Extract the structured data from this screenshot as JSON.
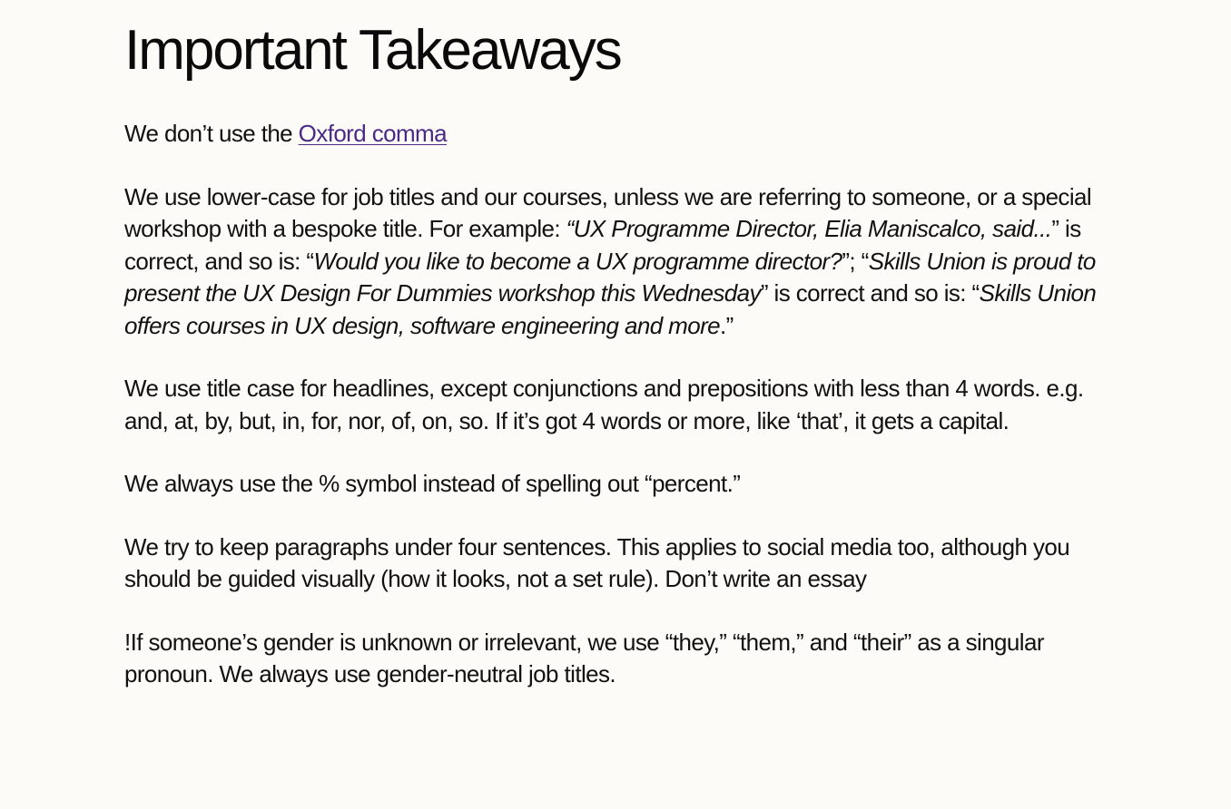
{
  "heading": "Important Takeaways",
  "paragraphs": {
    "oxford": {
      "before": "We don’t use the ",
      "link": "Oxford comma"
    },
    "lowercase": {
      "t1": "We use lower-case for job titles and our courses, unless we are referring to someone, or a special workshop with a bespoke title. For example: ",
      "i1": "“UX Programme Director, Elia Maniscalco, said...",
      "t2": "” is correct, and so is: “",
      "i2": "Would you like to become a UX programme director?",
      "t3": "”; “",
      "i3": "Skills Union is proud to present the UX Design For Dummies workshop this Wednesday",
      "t4": "” is correct and so is: “",
      "i4": "Skills Union offers courses in UX design, software engineering and more",
      "t5": ".”"
    },
    "titlecase": "We use title case for headlines, except conjunctions and prepositions with less than 4 words. e.g. and, at, by, but, in, for, nor, of, on, so. If it’s got 4 words or more, like ‘that’, it gets a capital.",
    "percent": "We always use the % symbol instead of spelling out “percent.”",
    "sentences": "We try to keep paragraphs under four sentences. This applies to social media too, although you should be guided visually (how it looks, not a set rule). Don’t write an essay",
    "gender": "!If someone’s gender is unknown or irrelevant, we use “they,” “them,” and “their” as a singular pronoun. We always use gender-neutral job titles."
  },
  "colors": {
    "background": "#fdfbf7",
    "text": "#111111",
    "link": "#4a2a86"
  }
}
